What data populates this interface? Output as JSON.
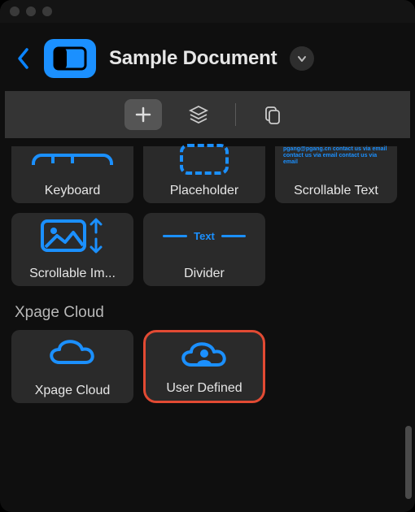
{
  "header": {
    "title": "Sample Document"
  },
  "tiles_row_partial": [
    {
      "label": "Keyboard",
      "name": "tile-keyboard"
    },
    {
      "label": "Placeholder",
      "name": "tile-placeholder"
    },
    {
      "label": "Scrollable Text",
      "name": "tile-scrollable-text"
    }
  ],
  "tiles_row2": [
    {
      "label": "Scrollable Im...",
      "name": "tile-scrollable-image"
    },
    {
      "label": "Divider",
      "name": "tile-divider"
    }
  ],
  "section": {
    "title": "Xpage Cloud"
  },
  "cloud_tiles": [
    {
      "label": "Xpage Cloud",
      "name": "tile-xpage-cloud"
    },
    {
      "label": "User Defined",
      "name": "tile-user-defined",
      "highlighted": true
    }
  ],
  "divider_sample_text": "Text",
  "scrollable_text_sample": "pgang@pgang.cn contact us via email contact us via email contact us via email"
}
